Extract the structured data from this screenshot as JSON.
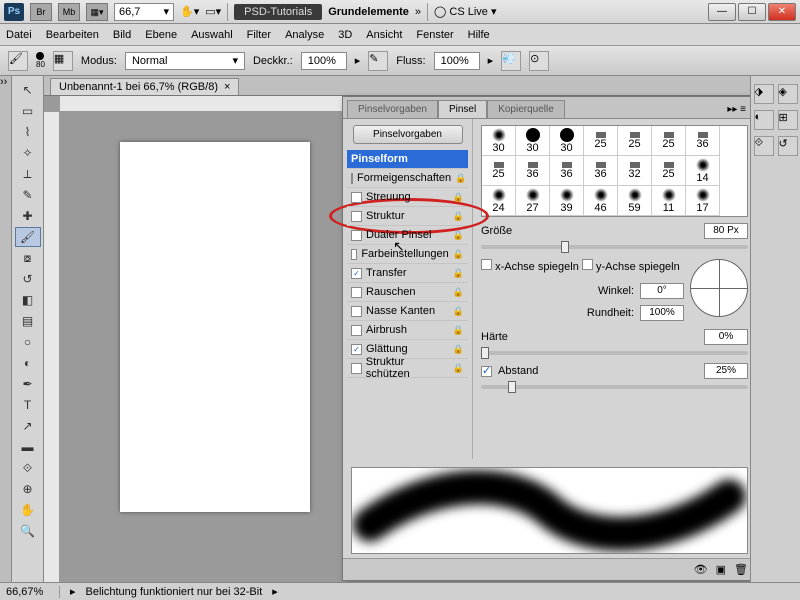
{
  "titlebar": {
    "ps": "Ps",
    "br": "Br",
    "mb": "Mb",
    "zoom": "66,7",
    "arrows": "»",
    "chip1": "PSD-Tutorials",
    "chip2": "Grundelemente",
    "cslive": "CS Live"
  },
  "menu": [
    "Datei",
    "Bearbeiten",
    "Bild",
    "Ebene",
    "Auswahl",
    "Filter",
    "Analyse",
    "3D",
    "Ansicht",
    "Fenster",
    "Hilfe"
  ],
  "optbar": {
    "brush_size": "80",
    "modus_label": "Modus:",
    "modus_value": "Normal",
    "deckk_label": "Deckkr.:",
    "deckk_value": "100%",
    "fluss_label": "Fluss:",
    "fluss_value": "100%"
  },
  "doc_tab": "Unbenannt-1 bei 66,7% (RGB/8)",
  "panel": {
    "tabs": [
      "Pinselvorgaben",
      "Pinsel",
      "Kopierquelle"
    ],
    "preset_btn": "Pinselvorgaben",
    "rows": [
      {
        "label": "Pinselform",
        "sel": true,
        "cb": null
      },
      {
        "label": "Formeigenschaften",
        "cb": false
      },
      {
        "label": "Streuung",
        "cb": false
      },
      {
        "label": "Struktur",
        "cb": false
      },
      {
        "label": "Dualer Pinsel",
        "cb": false
      },
      {
        "label": "Farbeinstellungen",
        "cb": false
      },
      {
        "label": "Transfer",
        "cb": true
      },
      {
        "label": "Rauschen",
        "cb": false
      },
      {
        "label": "Nasse Kanten",
        "cb": false
      },
      {
        "label": "Airbrush",
        "cb": false
      },
      {
        "label": "Glättung",
        "cb": true
      },
      {
        "label": "Struktur schützen",
        "cb": false
      }
    ],
    "tips": [
      [
        "30",
        "30",
        "30",
        "25",
        "25",
        "25",
        "36"
      ],
      [
        "25",
        "36",
        "36",
        "36",
        "32",
        "25",
        "14"
      ],
      [
        "24",
        "27",
        "39",
        "46",
        "59",
        "11",
        "17"
      ]
    ],
    "size_label": "Größe",
    "size_value": "80 Px",
    "flipx": "x-Achse spiegeln",
    "flipy": "y-Achse spiegeln",
    "angle_label": "Winkel:",
    "angle_value": "0°",
    "round_label": "Rundheit:",
    "round_value": "100%",
    "hardness_label": "Härte",
    "hardness_value": "0%",
    "spacing_label": "Abstand",
    "spacing_value": "25%"
  },
  "status": {
    "zoom": "66,67%",
    "msg": "Belichtung funktioniert nur bei 32-Bit"
  }
}
